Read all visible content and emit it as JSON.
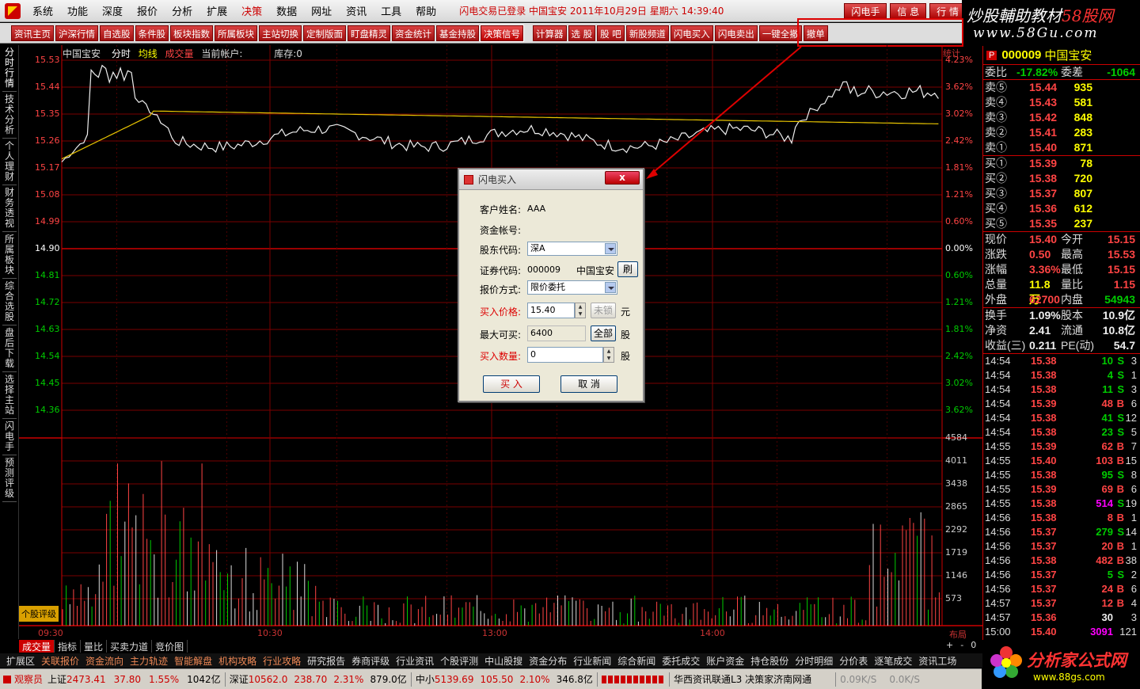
{
  "menubar": {
    "items": [
      "系统",
      "功能",
      "深度",
      "报价",
      "分析",
      "扩展",
      "决策",
      "数据",
      "网址",
      "资讯",
      "工具",
      "帮助"
    ],
    "active": "决策",
    "status": "闪电交易已登录  中国宝安  2011年10月29日  星期六  14:39:40",
    "right_buttons": [
      "闪电手",
      "信 息",
      "行 情"
    ]
  },
  "watermark": {
    "line1_a": "炒股輔助教材",
    "line1_b": "58股网",
    "line2": "www.58Gu.com"
  },
  "toolbar": {
    "buttons": [
      "资讯主页",
      "沪深行情",
      "自选股",
      "条件股",
      "板块指数",
      "所属板块",
      "主站切换",
      "定制版面",
      "盯盘精灵",
      "资金统计",
      "基金持股",
      "决策信号",
      "计算器",
      "选 股",
      "股 吧",
      "新股频道",
      "闪电买入",
      "闪电卖出",
      "一键全撤",
      "撤单"
    ],
    "highlight": "决策信号"
  },
  "left_tabs": [
    "分时行情",
    "技术分析",
    "个人理财",
    "财务透视",
    "所属板块",
    "综合选股",
    "盘后下载",
    "选择主站",
    "闪电手",
    "预测评级"
  ],
  "chart": {
    "header": {
      "name": "中国宝安",
      "w": "分时",
      "avg": "均线",
      "vol": "成交量",
      "acct": "当前帐户:",
      "stock": "库存:0"
    },
    "corner": "统计",
    "price_labels": [
      "15.53",
      "15.44",
      "15.35",
      "15.26",
      "15.17",
      "15.08",
      "14.99",
      "14.90",
      "14.81",
      "14.72",
      "14.63",
      "14.54",
      "14.45",
      "14.36"
    ],
    "pct_labels": [
      "4.23%",
      "3.62%",
      "3.02%",
      "2.42%",
      "1.81%",
      "1.21%",
      "0.60%",
      "0.00%",
      "0.60%",
      "1.21%",
      "1.81%",
      "2.42%",
      "3.02%",
      "3.62%"
    ],
    "vol_labels": [
      "4584",
      "4011",
      "3438",
      "2865",
      "2292",
      "1719",
      "1146",
      "573"
    ],
    "time_labels": [
      "09:30",
      "10:30",
      "13:00",
      "14:00"
    ],
    "layout_label": "布局",
    "review_label": "个股评级"
  },
  "subtabs": [
    "成交量",
    "指标",
    "量比",
    "买卖力道",
    "竞价图"
  ],
  "scroll": [
    "+",
    "-",
    "0"
  ],
  "funcrow": [
    "扩展区",
    "关联报价",
    "资金流向",
    "主力轨迹",
    "智能解盘",
    "机构攻略",
    "行业攻略",
    "研究报告",
    "券商评级",
    "行业资讯",
    "个股评测",
    "中山股搜",
    "资金分布",
    "行业新闻",
    "综合新闻",
    "委托成交",
    "账户资金",
    "持仓股份",
    "分时明细",
    "分价表",
    "逐笔成交",
    "资讯工场"
  ],
  "statusbar": {
    "user": "观察员",
    "sh_label": "上证",
    "sh_val": "2473.41",
    "sh_chg": "37.80",
    "sh_pct": "1.55%",
    "sh_amt": "1042亿",
    "sz_label": "深证",
    "sz_val": "10562.0",
    "sz_chg": "238.70",
    "sz_pct": "2.31%",
    "sz_amt": "879.0亿",
    "zx_label": "中小",
    "zx_val": "5139.69",
    "zx_chg": "105.50",
    "zx_pct": "2.10%",
    "zx_amt": "346.8亿",
    "server": "华西资讯联通L3  决策家济南网通",
    "net1": "0.09K/S",
    "net2": "0.0K/S"
  },
  "quote": {
    "p": "P",
    "code": "000009",
    "name": "中国宝安",
    "wb_label": "委比",
    "wb": "-17.82%",
    "wc_label": "委差",
    "wc": "-1064",
    "asks": [
      {
        "l": "卖⑤",
        "p": "15.44",
        "v": "935"
      },
      {
        "l": "卖④",
        "p": "15.43",
        "v": "581"
      },
      {
        "l": "卖③",
        "p": "15.42",
        "v": "848"
      },
      {
        "l": "卖②",
        "p": "15.41",
        "v": "283"
      },
      {
        "l": "卖①",
        "p": "15.40",
        "v": "871"
      }
    ],
    "bids": [
      {
        "l": "买①",
        "p": "15.39",
        "v": "78"
      },
      {
        "l": "买②",
        "p": "15.38",
        "v": "720"
      },
      {
        "l": "买③",
        "p": "15.37",
        "v": "807"
      },
      {
        "l": "买④",
        "p": "15.36",
        "v": "612"
      },
      {
        "l": "买⑤",
        "p": "15.35",
        "v": "237"
      }
    ],
    "stats": [
      {
        "a": "现价",
        "av": "15.40",
        "ac": "red",
        "b": "今开",
        "bv": "15.15",
        "bc": "red"
      },
      {
        "a": "涨跌",
        "av": "0.50",
        "ac": "red",
        "b": "最高",
        "bv": "15.53",
        "bc": "red"
      },
      {
        "a": "涨幅",
        "av": "3.36%",
        "ac": "red",
        "b": "最低",
        "bv": "15.15",
        "bc": "red"
      },
      {
        "a": "总量",
        "av": "11.8万",
        "ac": "yel",
        "b": "量比",
        "bv": "1.15",
        "bc": "red"
      },
      {
        "a": "外盘",
        "av": "62700",
        "ac": "red",
        "b": "内盘",
        "bv": "54943",
        "bc": "grn"
      }
    ],
    "stats2": [
      {
        "a": "换手",
        "av": "1.09%",
        "b": "股本",
        "bv": "10.9亿"
      },
      {
        "a": "净资",
        "av": "2.41",
        "b": "流通",
        "bv": "10.8亿"
      },
      {
        "a": "收益(三)",
        "av": "0.211",
        "b": "PE(动)",
        "bv": "54.7"
      }
    ],
    "ticks": [
      {
        "t": "14:54",
        "p": "15.38",
        "v": "10",
        "bs": "S",
        "n": "3"
      },
      {
        "t": "14:54",
        "p": "15.38",
        "v": "4",
        "bs": "S",
        "n": "1"
      },
      {
        "t": "14:54",
        "p": "15.38",
        "v": "11",
        "bs": "S",
        "n": "3"
      },
      {
        "t": "14:54",
        "p": "15.39",
        "v": "48",
        "bs": "B",
        "n": "6"
      },
      {
        "t": "14:54",
        "p": "15.38",
        "v": "41",
        "bs": "S",
        "n": "12"
      },
      {
        "t": "14:54",
        "p": "15.38",
        "v": "23",
        "bs": "S",
        "n": "5"
      },
      {
        "t": "14:55",
        "p": "15.39",
        "v": "62",
        "bs": "B",
        "n": "7"
      },
      {
        "t": "14:55",
        "p": "15.40",
        "v": "103",
        "bs": "B",
        "n": "15"
      },
      {
        "t": "14:55",
        "p": "15.38",
        "v": "95",
        "bs": "S",
        "n": "8"
      },
      {
        "t": "14:55",
        "p": "15.39",
        "v": "69",
        "bs": "B",
        "n": "6"
      },
      {
        "t": "14:55",
        "p": "15.38",
        "v": "514",
        "bs": "S",
        "n": "19"
      },
      {
        "t": "14:56",
        "p": "15.38",
        "v": "8",
        "bs": "B",
        "n": "1"
      },
      {
        "t": "14:56",
        "p": "15.37",
        "v": "279",
        "bs": "S",
        "n": "14"
      },
      {
        "t": "14:56",
        "p": "15.37",
        "v": "20",
        "bs": "B",
        "n": "1"
      },
      {
        "t": "14:56",
        "p": "15.38",
        "v": "482",
        "bs": "B",
        "n": "38"
      },
      {
        "t": "14:56",
        "p": "15.37",
        "v": "5",
        "bs": "S",
        "n": "2"
      },
      {
        "t": "14:56",
        "p": "15.37",
        "v": "24",
        "bs": "B",
        "n": "6"
      },
      {
        "t": "14:57",
        "p": "15.37",
        "v": "12",
        "bs": "B",
        "n": "4"
      },
      {
        "t": "14:57",
        "p": "15.36",
        "v": "30",
        "bs": "",
        "n": "3"
      },
      {
        "t": "15:00",
        "p": "15.40",
        "v": "3091",
        "bs": "",
        "n": "121"
      }
    ]
  },
  "logo88": {
    "t1": "分析家公式网",
    "t2": "www.88gs.com"
  },
  "dialog": {
    "title": "闪电买入",
    "close": "x",
    "customer_label": "客户姓名:",
    "customer": "AAA",
    "fund_label": "资金帐号:",
    "holder_label": "股东代码:",
    "holder": "深A",
    "code_label": "证券代码:",
    "code": "000009",
    "code_name": "中国宝安",
    "refresh": "刷",
    "quote_label": "报价方式:",
    "quote": "限价委托",
    "price_label": "买入价格:",
    "price": "15.40",
    "lock": "未锁",
    "unit_yuan": "元",
    "max_label": "最大可买:",
    "max": "6400",
    "all": "全部",
    "unit_gu": "股",
    "qty_label": "买入数量:",
    "qty": "0",
    "buy": "买 入",
    "cancel": "取 消"
  }
}
